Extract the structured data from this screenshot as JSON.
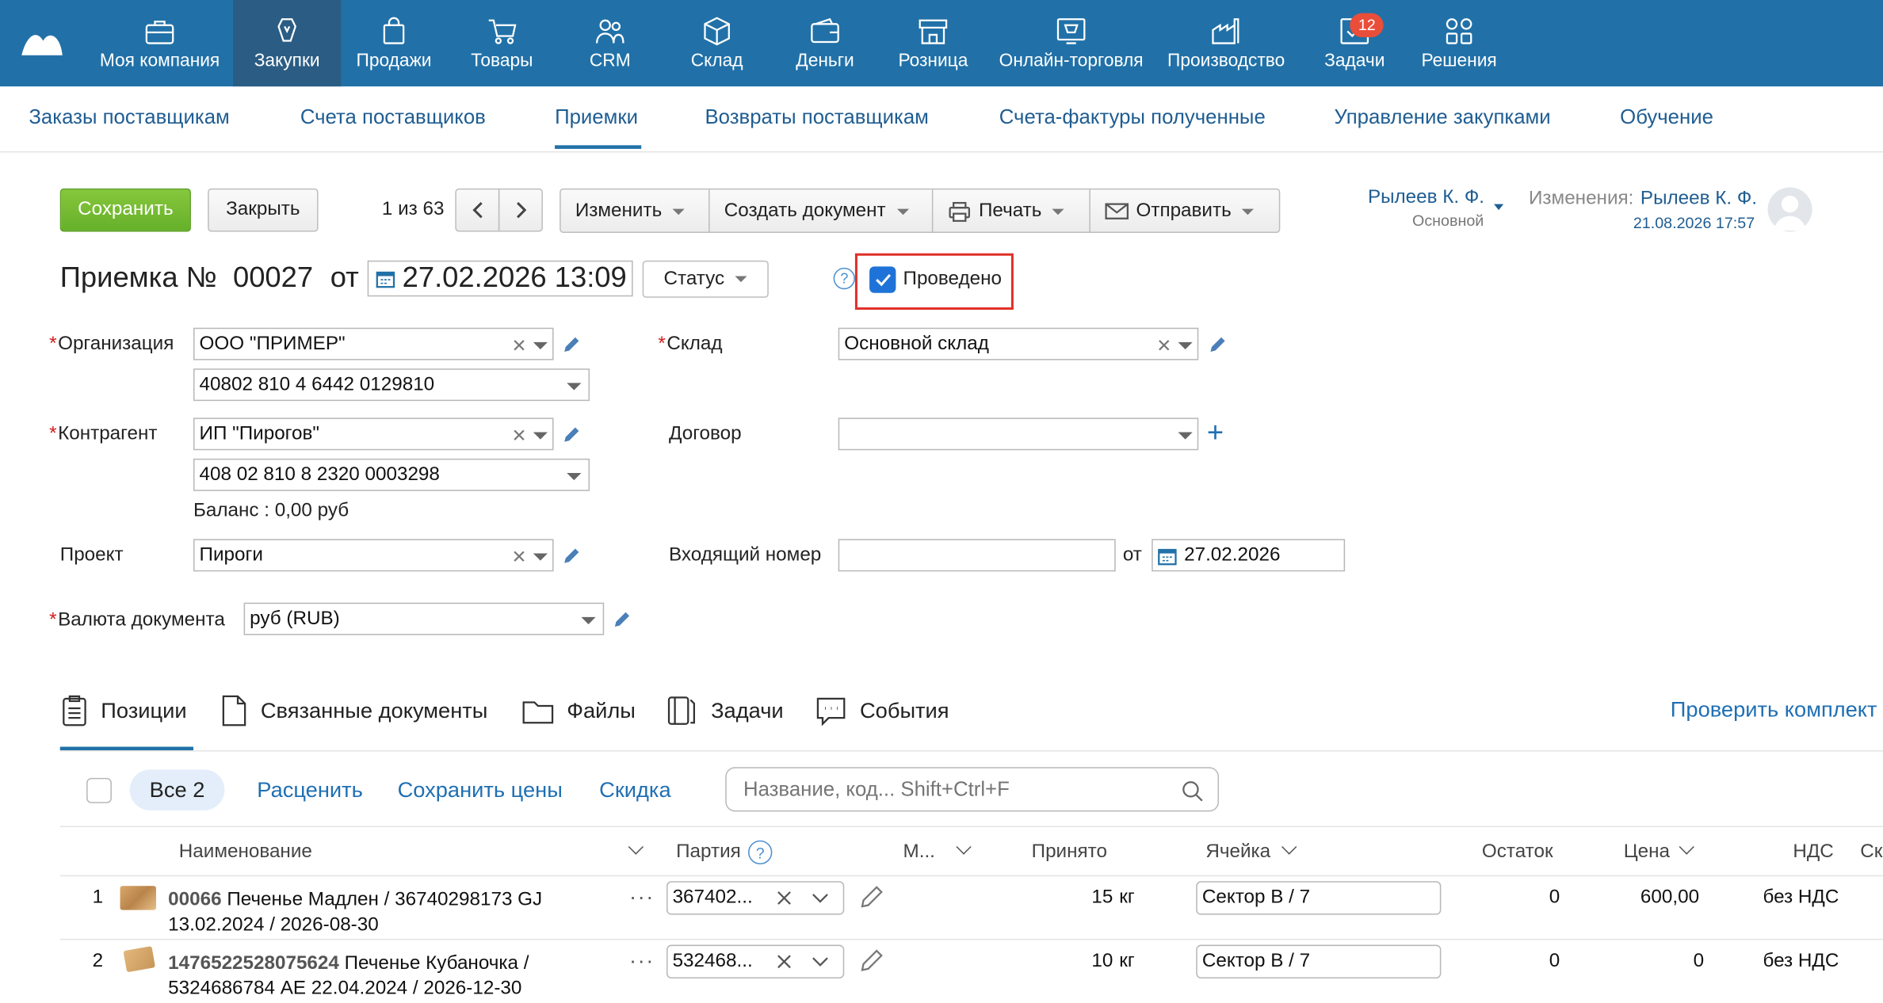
{
  "nav": {
    "items": [
      {
        "label": "Моя компания",
        "icon": "briefcase-icon"
      },
      {
        "label": "Закупки",
        "icon": "shopping-bag-hand-icon"
      },
      {
        "label": "Продажи",
        "icon": "shopping-bag-icon"
      },
      {
        "label": "Товары",
        "icon": "cart-icon"
      },
      {
        "label": "CRM",
        "icon": "people-icon"
      },
      {
        "label": "Склад",
        "icon": "box-icon"
      },
      {
        "label": "Деньги",
        "icon": "wallet-icon"
      },
      {
        "label": "Розница",
        "icon": "store-icon"
      },
      {
        "label": "Онлайн-торговля",
        "icon": "online-shop-icon"
      },
      {
        "label": "Производство",
        "icon": "factory-icon"
      },
      {
        "label": "Задачи",
        "icon": "tasks-icon",
        "badge": "12"
      },
      {
        "label": "Решения",
        "icon": "apps-icon"
      }
    ]
  },
  "subnav": {
    "items": [
      "Заказы поставщикам",
      "Счета поставщиков",
      "Приемки",
      "Возвраты поставщикам",
      "Счета-фактуры полученные",
      "Управление закупками",
      "Обучение"
    ]
  },
  "toolbar": {
    "save": "Сохранить",
    "close": "Закрыть",
    "pager": "1 из 63",
    "edit": "Изменить",
    "create_doc": "Создать документ",
    "print": "Печать",
    "send": "Отправить"
  },
  "user": {
    "name": "Рылеев К. Ф.",
    "role": "Основной",
    "changes_label": "Изменения:",
    "changes_user": "Рылеев К. Ф.",
    "changes_date": "21.08.2026 17:57"
  },
  "doc": {
    "title": "Приемка №",
    "number": "00027",
    "from": "от",
    "date": "27.02.2026 13:09",
    "status": "Статус",
    "posted_label": "Проведено",
    "posted": true
  },
  "form": {
    "org_label": "Организация",
    "org": "ООО \"ПРИМЕР\"",
    "org_account": "40802 810 4 6442 0129810",
    "warehouse_label": "Склад",
    "warehouse": "Основной склад",
    "counterparty_label": "Контрагент",
    "counterparty": "ИП \"Пирогов\"",
    "counterparty_account": "408 02 810 8 2320 0003298",
    "contract_label": "Договор",
    "contract": "",
    "balance": "Баланс : 0,00 руб",
    "project_label": "Проект",
    "project": "Пироги",
    "incoming_label": "Входящий номер",
    "incoming": "",
    "incoming_from": "от",
    "incoming_date": "27.02.2026",
    "currency_label": "Валюта документа",
    "currency": "руб (RUB)"
  },
  "tabs": [
    "Позиции",
    "Связанные документы",
    "Файлы",
    "Задачи",
    "События"
  ],
  "check_link": "Проверить комплект",
  "positions": {
    "all": "Все 2",
    "reprice": "Расценить",
    "save_prices": "Сохранить цены",
    "discount": "Скидка",
    "search_placeholder": "Название, код... Shift+Ctrl+F",
    "columns": {
      "name": "Наименование",
      "batch": "Партия",
      "m": "М...",
      "accepted": "Принято",
      "cell": "Ячейка",
      "rest": "Остаток",
      "price": "Цена",
      "vat": "НДС",
      "extra": "Ск"
    },
    "rows": [
      {
        "num": "1",
        "code": "00066",
        "name1": "Печенье Мадлен / 36740298173 GJ",
        "name2": "13.02.2024 / 2026-08-30",
        "batch": "367402...",
        "qty": "15",
        "unit": "кг",
        "cell": "Сектор В / 7",
        "rest": "0",
        "price": "600,00",
        "vat": "без НДС"
      },
      {
        "num": "2",
        "code": "1476522528075624",
        "name1": "Печенье Кубаночка /",
        "name2": "5324686784 AE 22.04.2024 / 2026-12-30",
        "batch": "532468...",
        "qty": "10",
        "unit": "кг",
        "cell": "Сектор В / 7",
        "rest": "0",
        "price": "0",
        "vat": "без НДС"
      }
    ]
  }
}
